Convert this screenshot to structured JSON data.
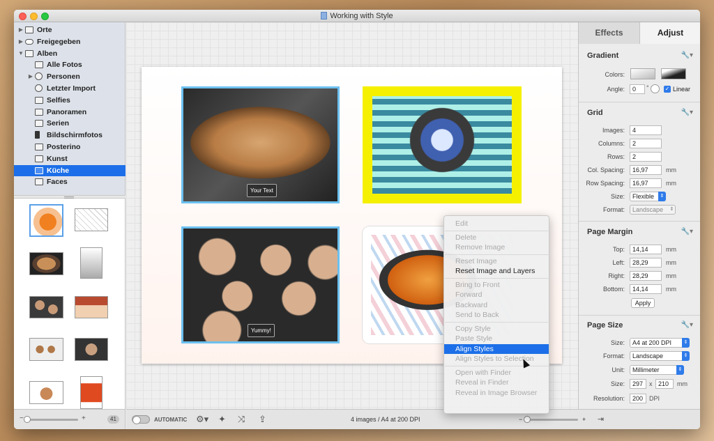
{
  "window": {
    "title": "Working with Style"
  },
  "sidebar": {
    "items": [
      {
        "label": "Orte",
        "icon": "folder-icon",
        "level": 0,
        "arrow": "▶"
      },
      {
        "label": "Freigegeben",
        "icon": "cloud-icon",
        "level": 0,
        "arrow": "▶"
      },
      {
        "label": "Alben",
        "icon": "folder-icon",
        "level": 0,
        "arrow": "▼"
      },
      {
        "label": "Alle Fotos",
        "icon": "album-icon",
        "level": 1,
        "arrow": ""
      },
      {
        "label": "Personen",
        "icon": "person-icon",
        "level": 1,
        "arrow": "▶"
      },
      {
        "label": "Letzter Import",
        "icon": "clock-icon",
        "level": 1,
        "arrow": ""
      },
      {
        "label": "Selfies",
        "icon": "camera-icon",
        "level": 1,
        "arrow": ""
      },
      {
        "label": "Panoramen",
        "icon": "panorama-icon",
        "level": 1,
        "arrow": ""
      },
      {
        "label": "Serien",
        "icon": "stack-icon",
        "level": 1,
        "arrow": ""
      },
      {
        "label": "Bildschirmfotos",
        "icon": "phone-icon",
        "level": 1,
        "arrow": ""
      },
      {
        "label": "Posterino",
        "icon": "album-icon",
        "level": 1,
        "arrow": ""
      },
      {
        "label": "Kunst",
        "icon": "album-icon",
        "level": 1,
        "arrow": ""
      },
      {
        "label": "Küche",
        "icon": "album-icon",
        "level": 1,
        "arrow": "",
        "selected": true
      },
      {
        "label": "Faces",
        "icon": "album-icon",
        "level": 1,
        "arrow": ""
      }
    ],
    "thumb_count": "41"
  },
  "canvas": {
    "captions": {
      "bread": "Your Text",
      "buns": "Yummy!"
    },
    "accent_frame": "#6cc0f0",
    "yellow_frame": "#f5f000"
  },
  "context_menu": {
    "items": [
      {
        "label": "Edit",
        "enabled": false
      },
      {
        "sep": true
      },
      {
        "label": "Delete",
        "enabled": false
      },
      {
        "label": "Remove Image",
        "enabled": false
      },
      {
        "sep": true
      },
      {
        "label": "Reset Image",
        "enabled": false
      },
      {
        "label": "Reset Image and Layers",
        "enabled": true
      },
      {
        "sep": true
      },
      {
        "label": "Bring to Front",
        "enabled": false
      },
      {
        "label": "Forward",
        "enabled": false
      },
      {
        "label": "Backward",
        "enabled": false
      },
      {
        "label": "Send to Back",
        "enabled": false
      },
      {
        "sep": true
      },
      {
        "label": "Copy Style",
        "enabled": false
      },
      {
        "label": "Paste Style",
        "enabled": false
      },
      {
        "label": "Align Styles",
        "enabled": true,
        "highlight": true
      },
      {
        "label": "Align Styles to Selection",
        "enabled": false
      },
      {
        "sep": true
      },
      {
        "label": "Open with Finder",
        "enabled": false
      },
      {
        "label": "Reveal in Finder",
        "enabled": false
      },
      {
        "label": "Reveal in Image Browser",
        "enabled": false
      }
    ]
  },
  "inspector": {
    "tabs": {
      "effects": "Effects",
      "adjust": "Adjust"
    },
    "gradient": {
      "title": "Gradient",
      "colors_label": "Colors:",
      "angle_label": "Angle:",
      "angle_value": "0",
      "angle_unit": "°",
      "linear_label": "Linear"
    },
    "grid": {
      "title": "Grid",
      "images_label": "Images:",
      "images": "4",
      "columns_label": "Columns:",
      "columns": "2",
      "rows_label": "Rows:",
      "rows": "2",
      "col_spacing_label": "Col. Spacing:",
      "col_spacing": "16,97",
      "row_spacing_label": "Row Spacing:",
      "row_spacing": "16,97",
      "size_label": "Size:",
      "size": "Flexible",
      "format_label": "Format:",
      "format": "Landscape",
      "unit": "mm"
    },
    "margin": {
      "title": "Page Margin",
      "top_label": "Top:",
      "top": "14,14",
      "left_label": "Left:",
      "left": "28,29",
      "right_label": "Right:",
      "right": "28,29",
      "bottom_label": "Bottom:",
      "bottom": "14,14",
      "apply": "Apply",
      "unit": "mm"
    },
    "page_size": {
      "title": "Page Size",
      "size_label": "Size:",
      "size": "A4 at 200 DPI",
      "format_label": "Format:",
      "format": "Landscape",
      "unit_label": "Unit:",
      "unit": "Millimeter",
      "dim_label": "Size:",
      "width": "297",
      "x": "x",
      "height": "210",
      "dim_unit": "mm",
      "res_label": "Resolution:",
      "resolution": "200",
      "res_unit": "DPI"
    }
  },
  "bottombar": {
    "automatic": "AUTOMATIC",
    "status": "4 images / A4 at 200 DPI",
    "minus": "−",
    "plus": "+"
  }
}
